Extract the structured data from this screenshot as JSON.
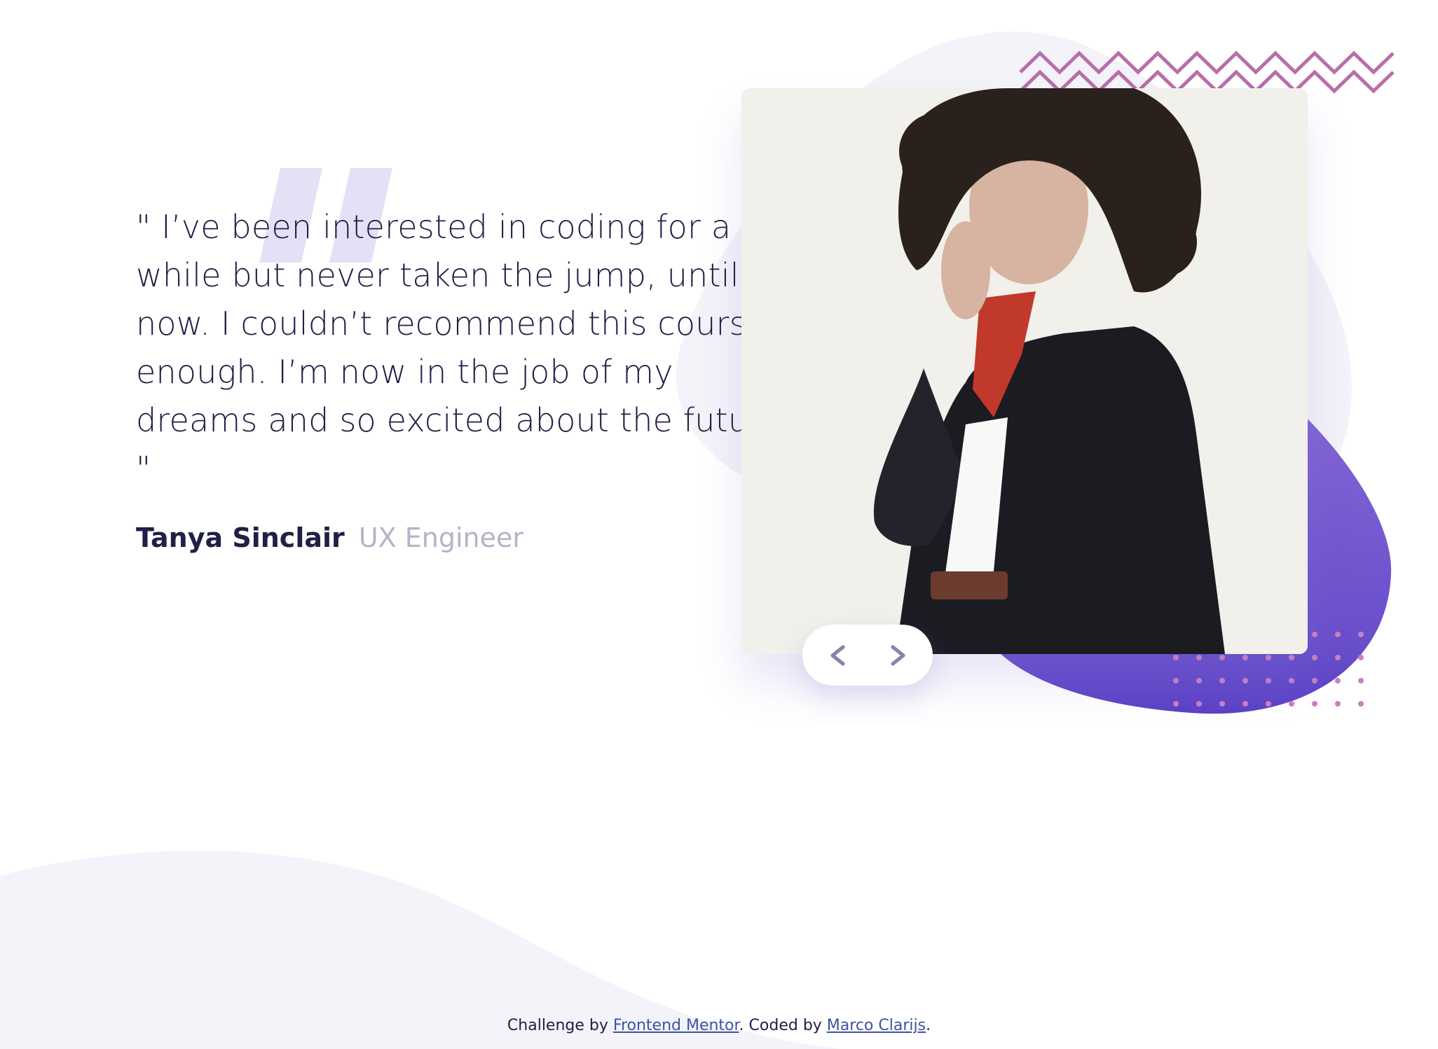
{
  "testimonial": {
    "quote": "\" I’ve been interested in coding for a while but never taken the jump, until now. I couldn’t recommend this course enough. I’m now in the job of my dreams and so excited about the future. \"",
    "author_name": "Tanya Sinclair",
    "author_role": "UX Engineer"
  },
  "photo": {
    "subject": "woman with curly hair wearing black coat and red scarf"
  },
  "nav": {
    "prev_icon": "chevron-left-icon",
    "next_icon": "chevron-right-icon"
  },
  "footer": {
    "prefix": "Challenge by ",
    "link1": "Frontend Mentor",
    "middle": ". Coded by ",
    "link2": "Marco Clarijs",
    "suffix": "."
  },
  "colors": {
    "text_dark": "#202046",
    "text_muted": "#b6b3c8",
    "accent_purple": "#6c52cf",
    "accent_pink": "#b86fa8",
    "background_curve": "#f3f3f9"
  }
}
